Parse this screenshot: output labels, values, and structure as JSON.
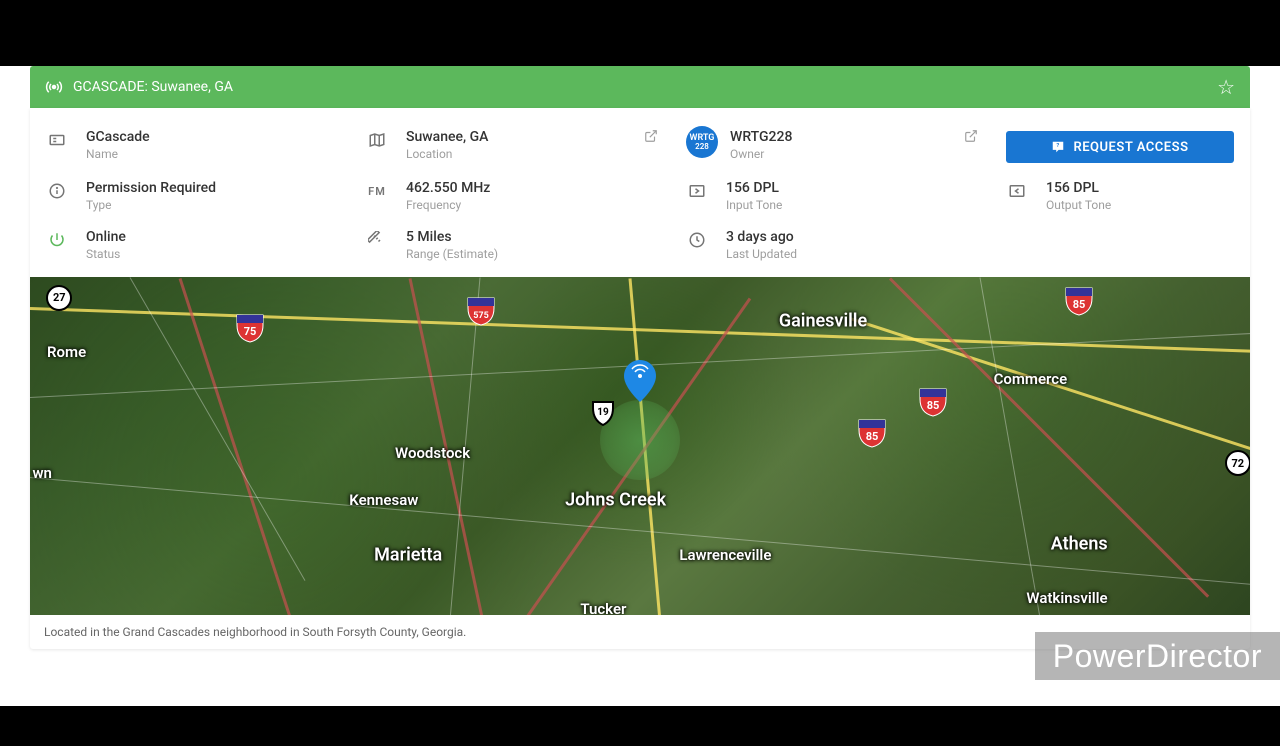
{
  "header": {
    "title": "GCASCADE: Suwanee, GA"
  },
  "details": {
    "name": {
      "value": "GCascade",
      "label": "Name"
    },
    "location": {
      "value": "Suwanee, GA",
      "label": "Location"
    },
    "owner": {
      "value": "WRTG228",
      "label": "Owner",
      "badge_top": "WRTG",
      "badge_bottom": "228"
    },
    "permission": {
      "value": "Permission Required",
      "label": "Type"
    },
    "frequency": {
      "value": "462.550 MHz",
      "label": "Frequency",
      "prefix": "FM"
    },
    "input_tone": {
      "value": "156 DPL",
      "label": "Input Tone"
    },
    "output_tone": {
      "value": "156 DPL",
      "label": "Output Tone"
    },
    "status": {
      "value": "Online",
      "label": "Status"
    },
    "range": {
      "value": "5 Miles",
      "label": "Range (Estimate)"
    },
    "updated": {
      "value": "3 days ago",
      "label": "Last Updated"
    }
  },
  "actions": {
    "request": "REQUEST ACCESS"
  },
  "map_labels": {
    "gainesville": "Gainesville",
    "commerce": "Commerce",
    "athens": "Athens",
    "watkinsville": "Watkinsville",
    "lawrenceville": "Lawrenceville",
    "johns_creek": "Johns Creek",
    "tucker": "Tucker",
    "marietta": "Marietta",
    "kennesaw": "Kennesaw",
    "woodstock": "Woodstock",
    "rome": "Rome",
    "wn": "wn"
  },
  "routes": {
    "r27": "27",
    "r75": "75",
    "r575": "575",
    "r19": "19",
    "r85": "85",
    "r72": "72"
  },
  "description": "Located in the Grand Cascades neighborhood in South Forsyth County, Georgia.",
  "watermark": "PowerDirector"
}
